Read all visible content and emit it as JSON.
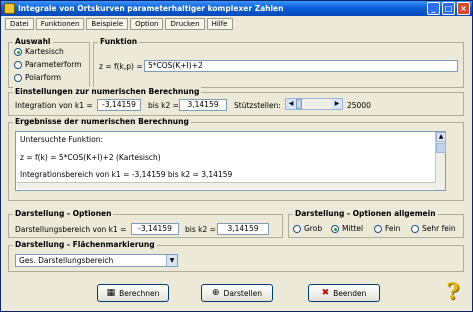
{
  "window": {
    "title": "Integrale von Ortskurven parameterhaltiger komplexer Zahlen",
    "controls": [
      "_",
      "□",
      "×"
    ]
  },
  "menu": [
    "Datei",
    "Funktionen",
    "Beispiele",
    "Option",
    "Drucken",
    "Hilfe"
  ],
  "auswahl": {
    "legend": "Auswahl",
    "options": [
      {
        "label": "Kartesisch",
        "selected": true
      },
      {
        "label": "Parameterform",
        "selected": false
      },
      {
        "label": "Polarform",
        "selected": false
      }
    ]
  },
  "funktion": {
    "legend": "Funktion",
    "label": "z = f(k,p) =",
    "value": "5*COS(K+I)+2"
  },
  "einstellungen": {
    "legend": "Einstellungen zur numerischen Berechnung",
    "k1_label": "Integration von k1 =",
    "k1_value": "-3,14159",
    "k2_label": "bis k2 =",
    "k2_value": "3,14159",
    "stuetz_label": "Stützstellen:",
    "stuetz_value": "25000"
  },
  "ergebnisse": {
    "legend": "Ergebnisse der numerischen Berechnung",
    "lines": [
      "Untersuchte Funktion:",
      "z = f(k) = 5*COS(K+I)+2  (Kartesisch)",
      "Integrationsbereich von k1 = -3,14159 bis k2 = 3,14159"
    ]
  },
  "darstellung_optionen": {
    "legend": "Darstellung - Optionen",
    "k1_label": "Darstellungsbereich von k1 =",
    "k1_value": "-3,14159",
    "k2_label": "bis k2 =",
    "k2_value": "3,14159"
  },
  "darstellung_allgemein": {
    "legend": "Darstellung - Optionen allgemein",
    "options": [
      {
        "label": "Grob",
        "selected": false
      },
      {
        "label": "Mittel",
        "selected": true
      },
      {
        "label": "Fein",
        "selected": false
      },
      {
        "label": "Sehr fein",
        "selected": false
      }
    ]
  },
  "flaechenmarkierung": {
    "legend": "Darstellung - Flächenmarkierung",
    "selected": "Ges. Darstellungsbereich"
  },
  "buttons": {
    "berechnen": "Berechnen",
    "darstellen": "Darstellen",
    "beenden": "Beenden"
  },
  "icons": {
    "calculator": "calculator-icon",
    "crosshair": "crosshair-icon",
    "exit": "exit-x-icon",
    "help": "help-question-icon"
  }
}
